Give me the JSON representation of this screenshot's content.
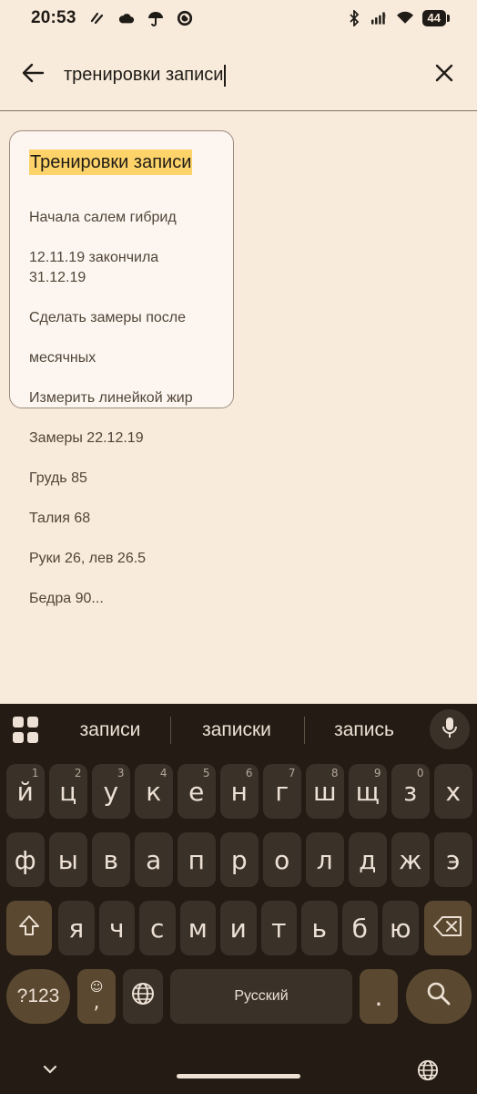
{
  "status_bar": {
    "time": "20:53",
    "battery": "44"
  },
  "search": {
    "query": "тренировки записи",
    "back_icon": "arrow-left-icon",
    "clear_icon": "close-icon"
  },
  "note": {
    "title": "Тренировки записи",
    "lines": [
      "Начала салем гибрид",
      "12.11.19 закончила 31.12.19",
      "Сделать замеры после",
      "месячных",
      "Измерить линейкой жир",
      "Замеры 22.12.19",
      "Грудь 85",
      "Талия 68",
      "Руки 26, лев 26.5",
      "Бедра 90..."
    ]
  },
  "keyboard": {
    "suggestions": [
      "записи",
      "записки",
      "запись"
    ],
    "row1": [
      {
        "k": "й",
        "h": "1"
      },
      {
        "k": "ц",
        "h": "2"
      },
      {
        "k": "у",
        "h": "3"
      },
      {
        "k": "к",
        "h": "4"
      },
      {
        "k": "е",
        "h": "5"
      },
      {
        "k": "н",
        "h": "6"
      },
      {
        "k": "г",
        "h": "7"
      },
      {
        "k": "ш",
        "h": "8"
      },
      {
        "k": "щ",
        "h": "9"
      },
      {
        "k": "з",
        "h": "0"
      },
      {
        "k": "х",
        "h": ""
      }
    ],
    "row2": [
      "ф",
      "ы",
      "в",
      "а",
      "п",
      "р",
      "о",
      "л",
      "д",
      "ж",
      "э"
    ],
    "row3": [
      "я",
      "ч",
      "с",
      "м",
      "и",
      "т",
      "ь",
      "б",
      "ю"
    ],
    "symbols_label": "?123",
    "comma_label": ",",
    "space_label": "Русский",
    "period_label": "."
  },
  "colors": {
    "background": "#f8ebdc",
    "highlight": "#fdd36a",
    "keyboard_bg": "#241c14",
    "key_bg": "#3a3128",
    "accent_key": "#5a4930"
  }
}
